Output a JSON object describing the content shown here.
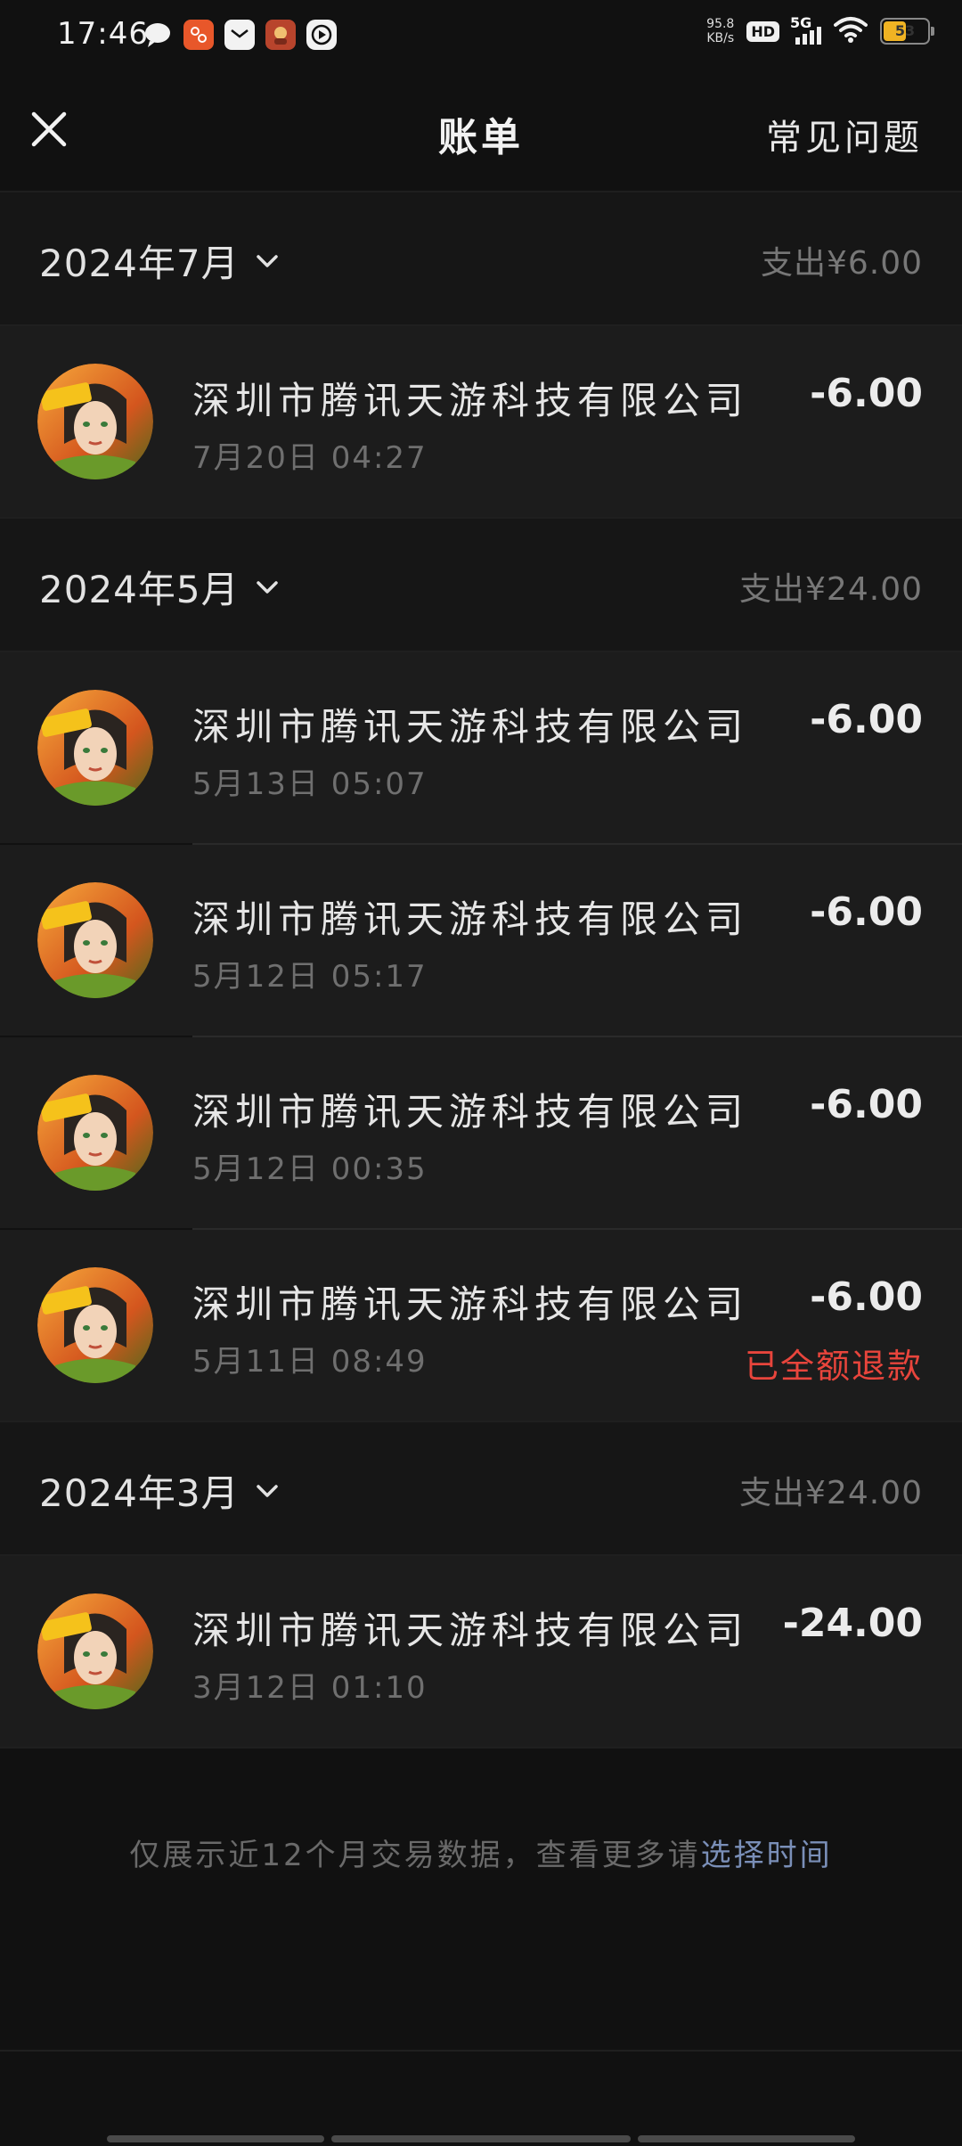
{
  "status_bar": {
    "time": "17:46",
    "net_speed_value": "95.8",
    "net_speed_unit": "KB/s",
    "hd": "HD",
    "network": "5G",
    "battery": "53",
    "battery_fraction": 0.53
  },
  "header": {
    "title": "账单",
    "faq": "常见问题"
  },
  "groups": [
    {
      "month": "2024年7月",
      "total": "支出¥6.00",
      "transactions": [
        {
          "merchant": "深圳市腾讯天游科技有限公司",
          "time": "7月20日 04:27",
          "amount": "-6.00"
        }
      ]
    },
    {
      "month": "2024年5月",
      "total": "支出¥24.00",
      "transactions": [
        {
          "merchant": "深圳市腾讯天游科技有限公司",
          "time": "5月13日 05:07",
          "amount": "-6.00"
        },
        {
          "merchant": "深圳市腾讯天游科技有限公司",
          "time": "5月12日 05:17",
          "amount": "-6.00"
        },
        {
          "merchant": "深圳市腾讯天游科技有限公司",
          "time": "5月12日 00:35",
          "amount": "-6.00"
        },
        {
          "merchant": "深圳市腾讯天游科技有限公司",
          "time": "5月11日 08:49",
          "amount": "-6.00",
          "status": "已全额退款"
        }
      ]
    },
    {
      "month": "2024年3月",
      "total": "支出¥24.00",
      "transactions": [
        {
          "merchant": "深圳市腾讯天游科技有限公司",
          "time": "3月12日 01:10",
          "amount": "-24.00"
        }
      ]
    }
  ],
  "footer": {
    "note": "仅展示近12个月交易数据，查看更多请",
    "link": "选择时间"
  },
  "colors": {
    "background": "#111111",
    "refund": "#e8453c",
    "link": "#7a8fb8"
  },
  "icons": {
    "close": "close-icon",
    "chevron": "chevron-down-icon",
    "avatar": "game-avatar-icon"
  }
}
